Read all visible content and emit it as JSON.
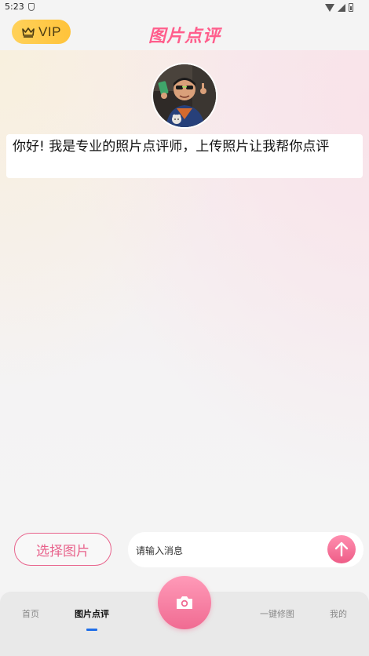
{
  "status_bar": {
    "time": "5:23"
  },
  "header": {
    "vip_label": "VIP",
    "title": "图片点评"
  },
  "chat": {
    "messages": [
      {
        "sender": "assistant",
        "text": "你好! 我是专业的照片点评师，上传照片让我帮你点评"
      }
    ]
  },
  "composer": {
    "choose_button": "选择图片",
    "input_placeholder": "请输入消息",
    "input_value": ""
  },
  "tabbar": {
    "tabs": [
      {
        "label": "首页",
        "active": false
      },
      {
        "label": "图片点评",
        "active": true
      },
      {
        "label": "一键修图",
        "active": false
      },
      {
        "label": "我的",
        "active": false
      }
    ],
    "center_icon": "camera-icon",
    "indicator_color": "#1f6ee8"
  },
  "colors": {
    "accent": "#ff5e8c",
    "vip": "#ffc33a"
  }
}
